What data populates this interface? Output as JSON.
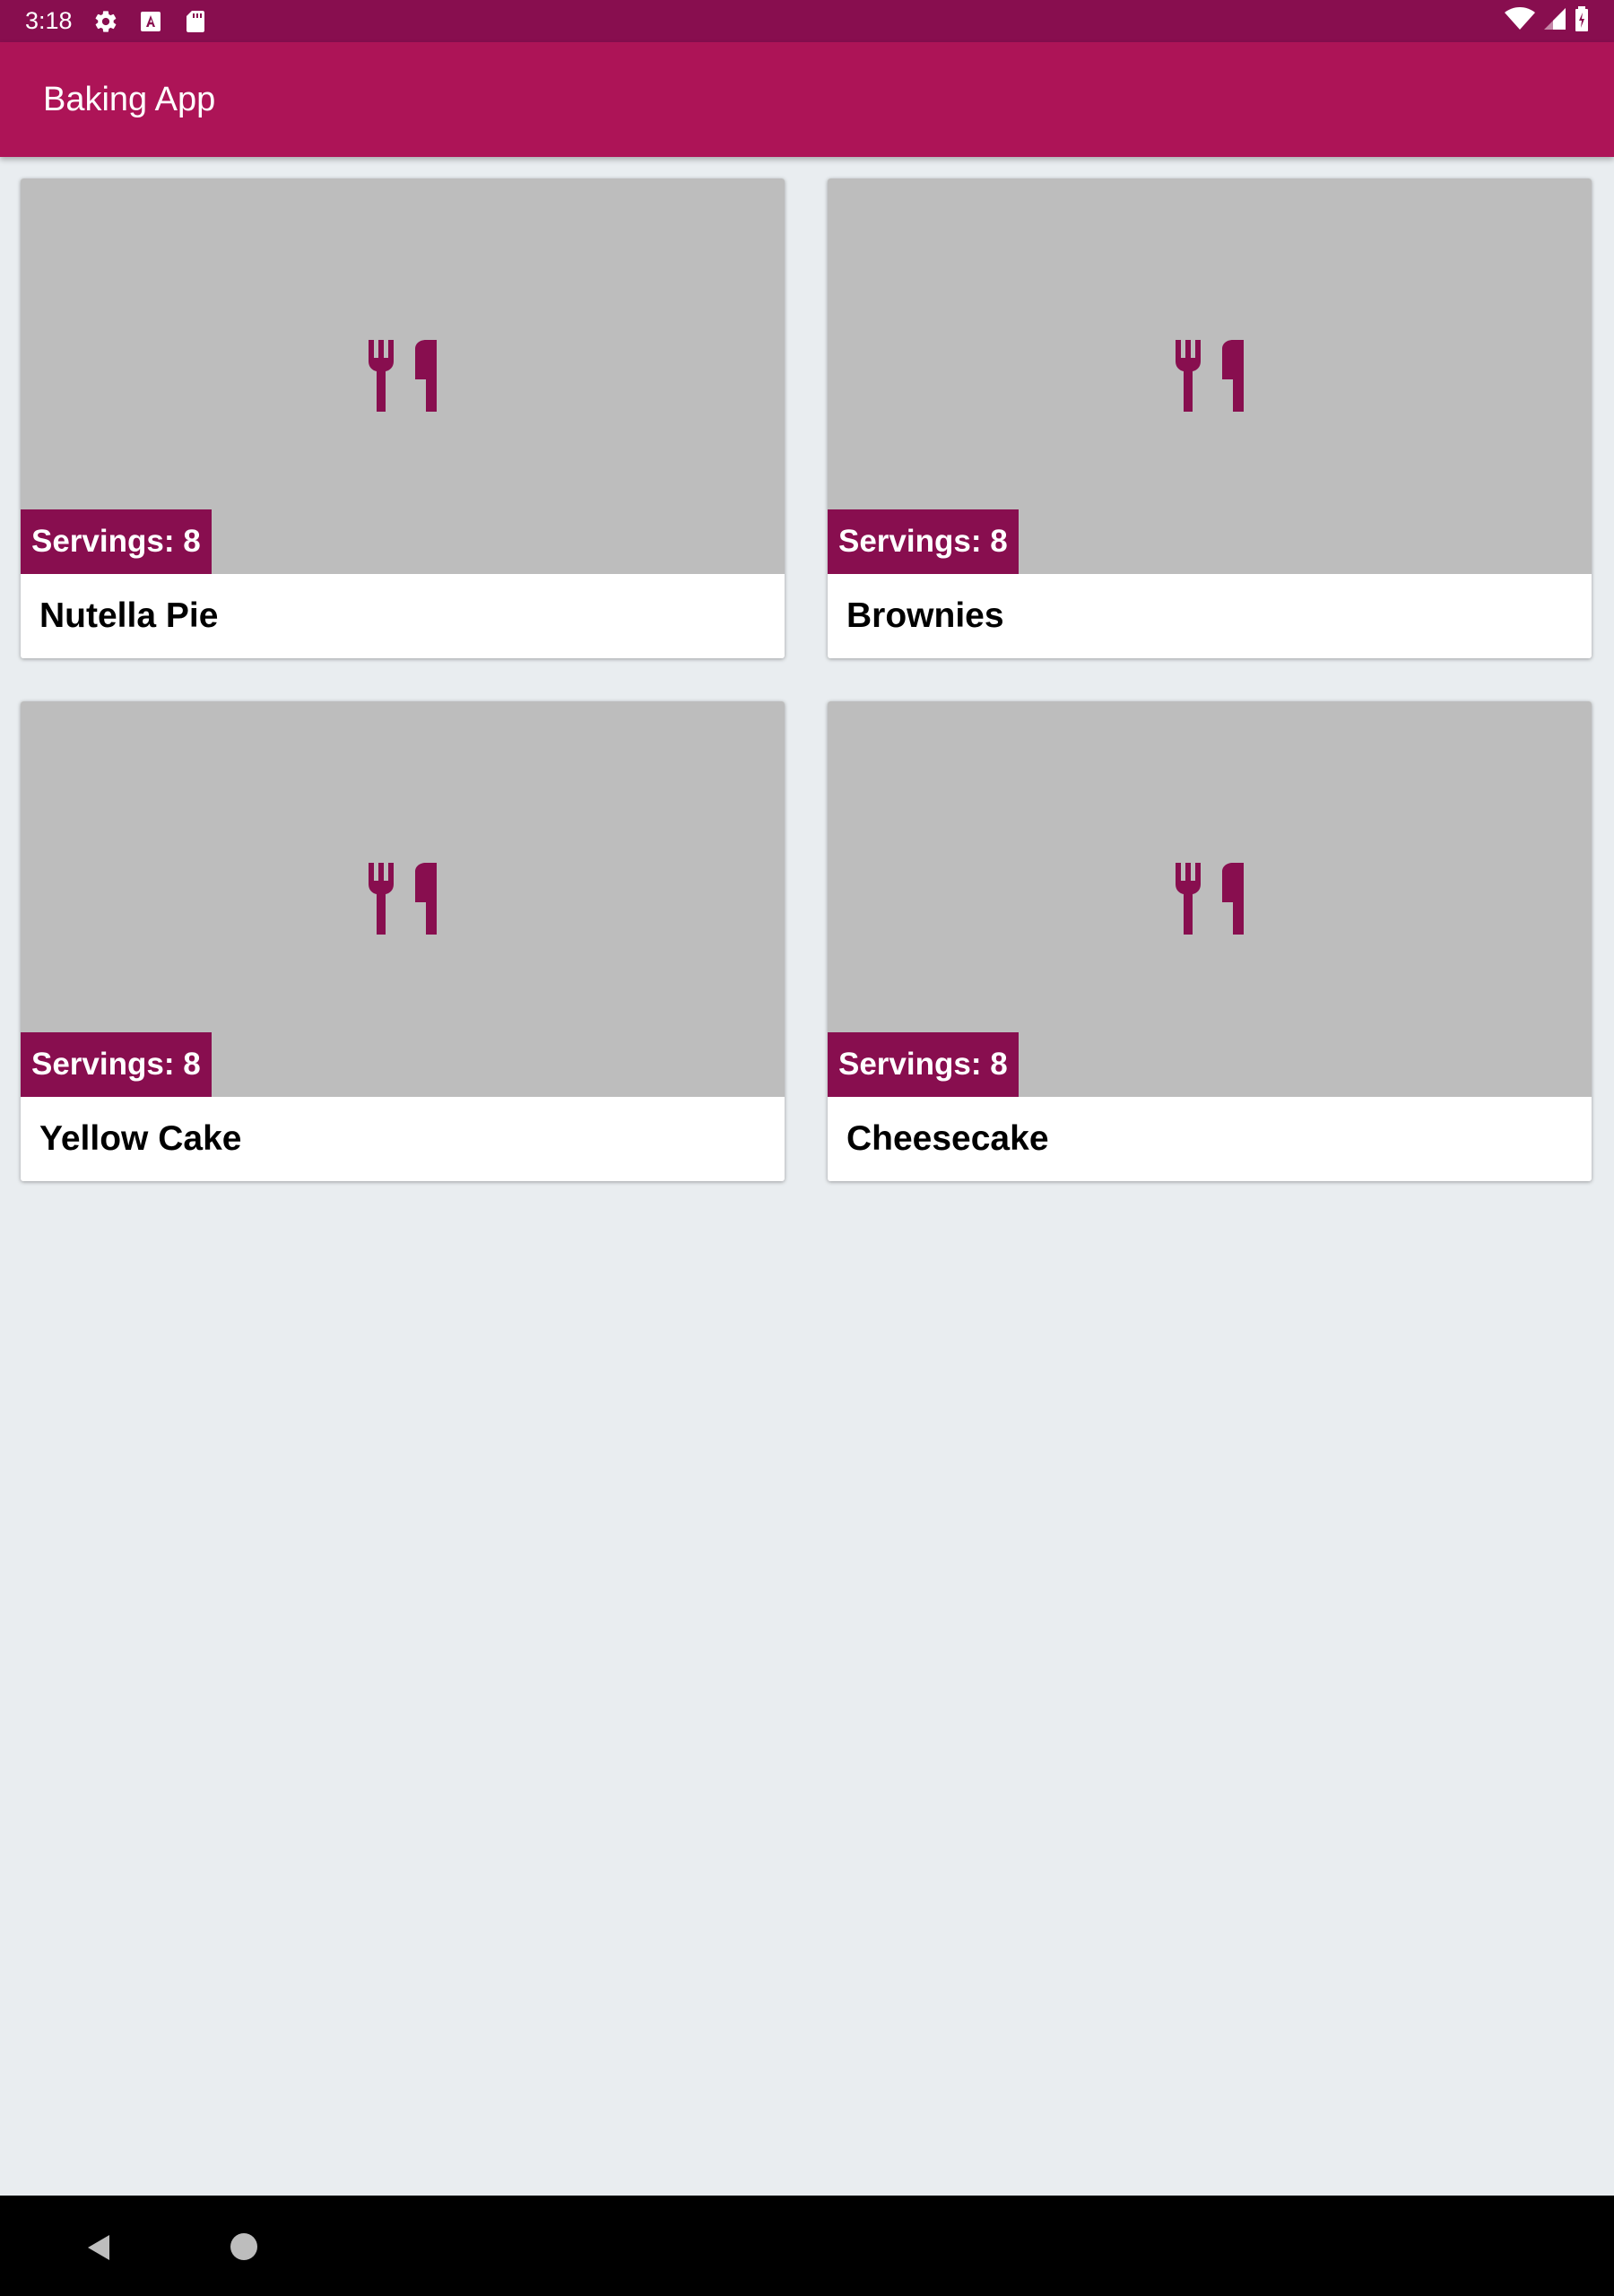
{
  "status_bar": {
    "time": "3:18",
    "left_icons": [
      "gear-icon",
      "a-icon",
      "sd-card-icon"
    ],
    "right_icons": [
      "wifi-icon",
      "signal-icon",
      "battery-icon"
    ]
  },
  "app_bar": {
    "title": "Baking App"
  },
  "colors": {
    "status_bar": "#880e4f",
    "app_bar": "#ad1457",
    "badge": "#880e4f",
    "icon": "#880e4f",
    "image_placeholder": "#bdbdbd",
    "background": "#e9edf0"
  },
  "recipes": [
    {
      "name": "Nutella Pie",
      "servings": "Servings: 8",
      "icon": "utensils-icon"
    },
    {
      "name": "Brownies",
      "servings": "Servings: 8",
      "icon": "utensils-icon"
    },
    {
      "name": "Yellow Cake",
      "servings": "Servings: 8",
      "icon": "utensils-icon"
    },
    {
      "name": "Cheesecake",
      "servings": "Servings: 8",
      "icon": "utensils-icon"
    }
  ],
  "nav_bar": {
    "icons": [
      "back-icon",
      "home-icon"
    ]
  }
}
